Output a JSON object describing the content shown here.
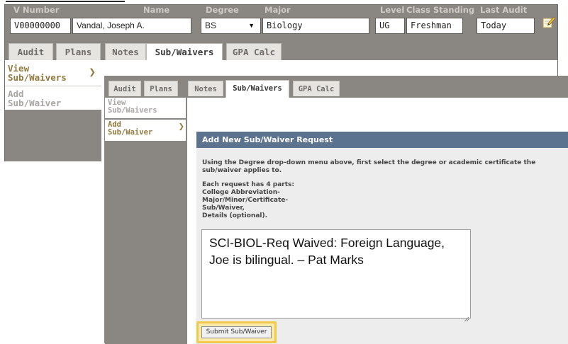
{
  "header": {
    "v_number_label": "V Number",
    "name_label": "Name",
    "degree_label": "Degree",
    "major_label": "Major",
    "level_label": "Level",
    "class_standing_label": "Class Standing",
    "last_audit_label": "Last Audit",
    "v_number": "V00000000",
    "name": "Vandal, Joseph A.",
    "degree": "BS",
    "major": "Biology",
    "level": "UG",
    "class_standing": "Freshman",
    "last_audit": "Today"
  },
  "tabs": [
    {
      "label": "Audit"
    },
    {
      "label": "Plans"
    },
    {
      "label": "Notes"
    },
    {
      "label": "Sub/Waivers"
    },
    {
      "label": "GPA Calc"
    }
  ],
  "sidebar": {
    "items": [
      {
        "label_line1": "View",
        "label_line2": "Sub/Waivers"
      },
      {
        "label_line1": "Add",
        "label_line2": "Sub/Waiver"
      }
    ]
  },
  "panel": {
    "title": "Add New Sub/Waiver Request",
    "instruction_line1": "Using the Degree drop-down menu above, first select the degree or academic certificate the",
    "instruction_line2": "sub/waiver applies to.",
    "parts_intro": "Each request has 4 parts:",
    "part1": "College Abbreviation-",
    "part2": "Major/Minor/Certificate-",
    "part3": "Sub/Waiver,",
    "part4": "Details (optional).",
    "textarea_value": "SCI-BIOL-Req Waived: Foreign Language, Joe is bilingual. – Pat Marks",
    "submit_label": "Submit Sub/Waiver"
  },
  "colors": {
    "frame_gray": "#8a8783",
    "accent_gold": "#8f7a3f",
    "panel_header_blue": "#5c7390",
    "highlight_yellow": "#f2c94c"
  }
}
